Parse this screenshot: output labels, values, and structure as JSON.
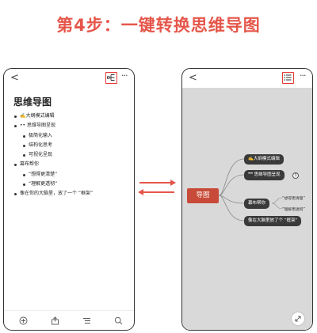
{
  "headline": "第4步：一键转换思维导图",
  "doc": {
    "back_glyph": "<",
    "more_glyph": "···",
    "title": "思维导图",
    "items": [
      {
        "text": "✍️大纲模式编辑"
      },
      {
        "text": "•• 思维导图呈现"
      },
      {
        "text": "极简化输入"
      },
      {
        "text": "结构化思考"
      },
      {
        "text": "可视化呈现"
      },
      {
        "text": "幕布帮你"
      },
      {
        "text": "“想得更清楚”"
      },
      {
        "text": "“理解更透彻”"
      },
      {
        "text": "像在你的大脑里，放了一个 “框架”"
      }
    ],
    "bottom_icons": [
      "add-icon",
      "share-icon",
      "outline-icon",
      "search-icon"
    ]
  },
  "mindmap": {
    "back_glyph": "<",
    "more_glyph": "···",
    "root": "导图",
    "nodes": [
      {
        "text": "✍️大纲模式编辑"
      },
      {
        "text": "❞❞ 思维导图呈现"
      },
      {
        "text": "幕布帮你"
      },
      {
        "text": "像在大脑里放了个 “框架”"
      }
    ],
    "collapse_count": "3",
    "leaves": [
      "“想得更清楚”",
      "“理解更透彻”"
    ]
  },
  "colors": {
    "accent": "#e5564a",
    "highlight_box": "#e53935",
    "root_node": "#c84b3a",
    "dark_node": "#3a3a3a",
    "canvas": "#d9d9d9"
  }
}
